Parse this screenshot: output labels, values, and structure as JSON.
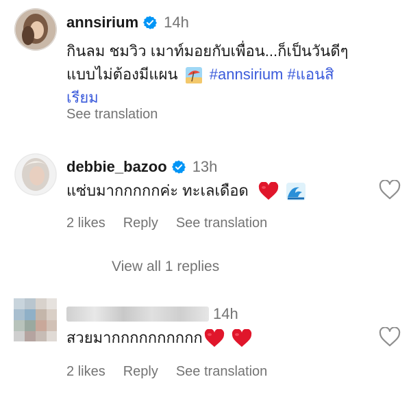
{
  "post": {
    "username": "annsirium",
    "time": "14h",
    "caption_line1": "กินลม ชมวิว เมาท์มอยกับเพื่อน...ก็เป็นวันดีๆ",
    "caption_line2_text": "แบบไม่ต้องมีแผน",
    "hashtag1": "#annsirium",
    "hashtag2_part1": "#แอนสิ",
    "hashtag2_part2": "เรียม",
    "see_translation": "See translation",
    "icons": {
      "verified": "verified-badge-icon",
      "beach": "beach-umbrella-emoji"
    }
  },
  "comments": [
    {
      "username": "debbie_bazoo",
      "time": "13h",
      "text": "แซ่บมากกกกกค่ะ ทะเลเดือด",
      "likes": "2 likes",
      "reply": "Reply",
      "see_translation": "See translation",
      "icons": [
        "red-heart-emoji",
        "wave-emoji",
        "like-heart-icon"
      ]
    },
    {
      "username_blurred": true,
      "time": "14h",
      "text": "สวยมากกกกกกกกกก",
      "likes": "2 likes",
      "reply": "Reply",
      "see_translation": "See translation",
      "icons": [
        "red-heart-emoji",
        "red-heart-emoji",
        "like-heart-icon"
      ]
    }
  ],
  "view_replies": "View all 1 replies",
  "colors": {
    "text": "#262626",
    "muted": "#737373",
    "hashtag": "#3b5bdb",
    "verified": "#0095f6",
    "heart": "#e0162b"
  }
}
